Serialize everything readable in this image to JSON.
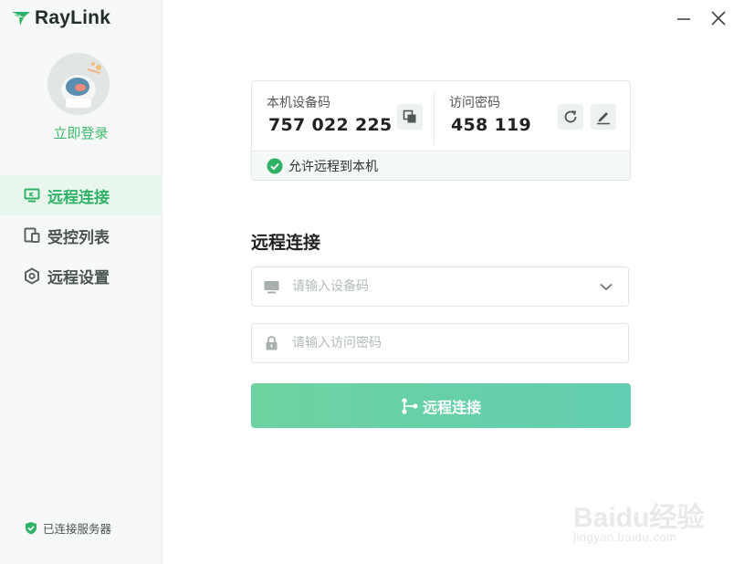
{
  "app": {
    "brand": "RayLink"
  },
  "sidebar": {
    "login_label": "立即登录",
    "items": [
      {
        "label": "远程连接",
        "icon": "monitor-icon",
        "active": true
      },
      {
        "label": "受控列表",
        "icon": "devices-icon",
        "active": false
      },
      {
        "label": "远程设置",
        "icon": "settings-hex-icon",
        "active": false
      }
    ],
    "status_label": "已连接服务器"
  },
  "device_card": {
    "device_code_label": "本机设备码",
    "device_code": "757 022 225",
    "password_label": "访问密码",
    "password": "458 119",
    "allow_remote_label": "允许远程到本机"
  },
  "connect": {
    "title": "远程连接",
    "device_placeholder": "请输入设备码",
    "password_placeholder": "请输入访问密码",
    "button_label": "远程连接"
  },
  "watermark": {
    "line1": "Baidu经验",
    "line2": "jingyan.baidu.com"
  },
  "colors": {
    "accent": "#3dba6b",
    "button": "#66d0a8",
    "sidebar_bg": "#f7f8f8"
  }
}
